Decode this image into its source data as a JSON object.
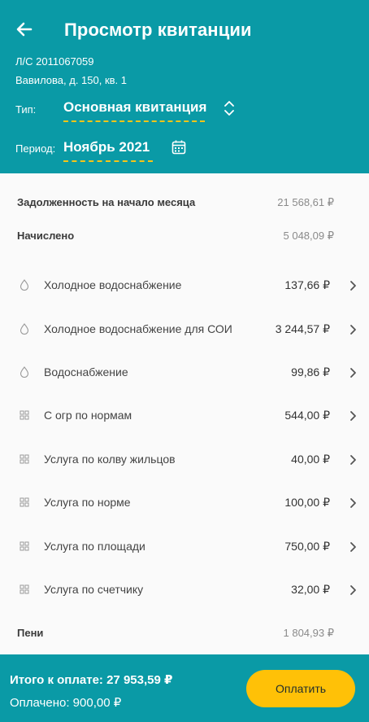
{
  "header": {
    "title": "Просмотр квитанции",
    "account": "Л/С 2011067059",
    "address": "Вавилова, д. 150, кв. 1",
    "type_label": "Тип:",
    "type_value": "Основная квитанция",
    "period_label": "Период:",
    "period_value": "Ноябрь 2021"
  },
  "summary": {
    "debt_label": "Задолженность на начало месяца",
    "debt_amount": "21 568,61 ₽",
    "charged_label": "Начислено",
    "charged_amount": "5 048,09 ₽",
    "penalty_label": "Пени",
    "penalty_amount": "1 804,93 ₽"
  },
  "services": [
    {
      "icon": "drop-icon",
      "name": "Холодное водоснабжение",
      "amount": "137,66 ₽"
    },
    {
      "icon": "drop-icon",
      "name": "Холодное водоснабжение для СОИ",
      "amount": "3 244,57 ₽"
    },
    {
      "icon": "drop-icon",
      "name": "Водоснабжение",
      "amount": "99,86 ₽"
    },
    {
      "icon": "grid-icon",
      "name": "С огр по нормам",
      "amount": "544,00 ₽"
    },
    {
      "icon": "grid-icon",
      "name": "Услуга по колву жильцов",
      "amount": "40,00 ₽"
    },
    {
      "icon": "grid-icon",
      "name": "Услуга по норме",
      "amount": "100,00 ₽"
    },
    {
      "icon": "grid-icon",
      "name": "Услуга по площади",
      "amount": "750,00 ₽"
    },
    {
      "icon": "grid-icon",
      "name": "Услуга по счетчику",
      "amount": "32,00 ₽"
    }
  ],
  "footer": {
    "total": "Итого к оплате: 27 953,59 ₽",
    "paid": "Оплачено: 900,00 ₽",
    "pay_button": "Оплатить"
  },
  "colors": {
    "primary": "#0a9aa6",
    "accent": "#ffc107",
    "underline": "#f5c518"
  }
}
